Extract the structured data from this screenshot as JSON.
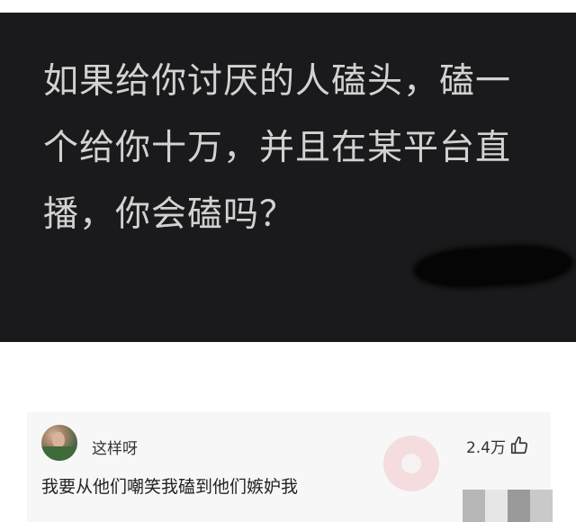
{
  "question": {
    "text": "如果给你讨厌的人磕头，磕一个给你十万，并且在某平台直播，你会磕吗？"
  },
  "comment": {
    "username": "这样呀",
    "likes": "2.4万",
    "text": "我要从他们嘲笑我磕到他们嫉妒我"
  },
  "icons": {
    "avatar": "user-avatar",
    "like": "thumbs-up-icon"
  }
}
